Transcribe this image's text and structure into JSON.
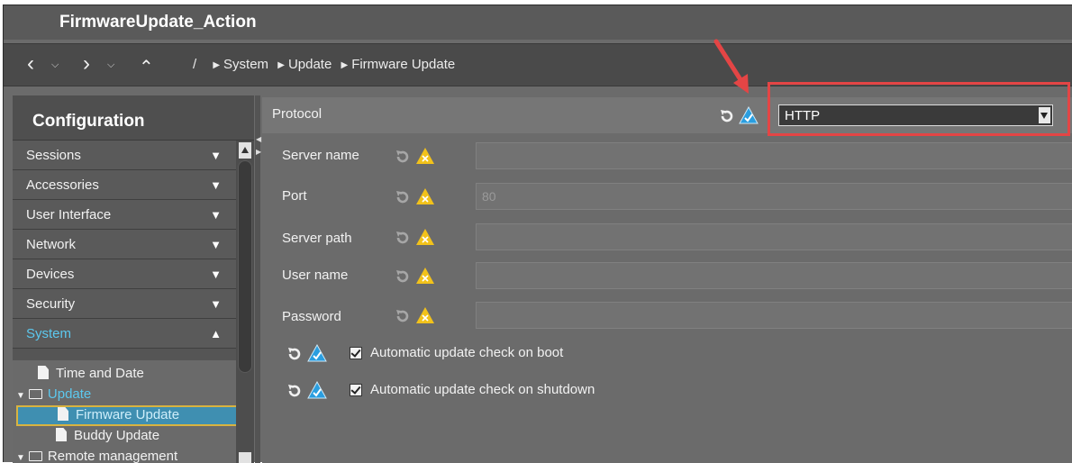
{
  "window": {
    "title": "FirmwareUpdate_Action"
  },
  "nav": {
    "back_label": "<",
    "forward_label": ">",
    "up_label": "^",
    "caret": "v",
    "breadcrumb": {
      "root": "/",
      "items": [
        "System",
        "Update",
        "Firmware Update"
      ]
    }
  },
  "sidebar": {
    "title": "Configuration",
    "items": [
      {
        "label": "Sessions",
        "arrow": "▼"
      },
      {
        "label": "Accessories",
        "arrow": "▼"
      },
      {
        "label": "User Interface",
        "arrow": "▼"
      },
      {
        "label": "Network",
        "arrow": "▼"
      },
      {
        "label": "Devices",
        "arrow": "▼"
      },
      {
        "label": "Security",
        "arrow": "▼"
      },
      {
        "label": "System",
        "arrow": "▲",
        "active": true
      }
    ],
    "tree": [
      {
        "label": "Time and Date"
      },
      {
        "label": "Update"
      },
      {
        "label": "Firmware Update",
        "selected": true
      },
      {
        "label": "Buddy Update"
      },
      {
        "label": "Remote management"
      }
    ]
  },
  "form": {
    "protocol_label": "Protocol",
    "protocol_value": "HTTP",
    "fields": [
      {
        "label": "Server name",
        "value": ""
      },
      {
        "label": "Port",
        "value": "80"
      },
      {
        "label": "Server path",
        "value": ""
      },
      {
        "label": "User name",
        "value": ""
      },
      {
        "label": "Password",
        "value": ""
      }
    ],
    "checkboxes": [
      {
        "label": "Automatic update check on boot",
        "checked": true
      },
      {
        "label": "Automatic update check on shutdown",
        "checked": true
      }
    ]
  },
  "colors": {
    "accent": "#5cc8ee",
    "highlight": "#e44545",
    "selected_bg": "#3f8fb1",
    "warning": "#f2c21a",
    "ok": "#2a9ee0"
  }
}
